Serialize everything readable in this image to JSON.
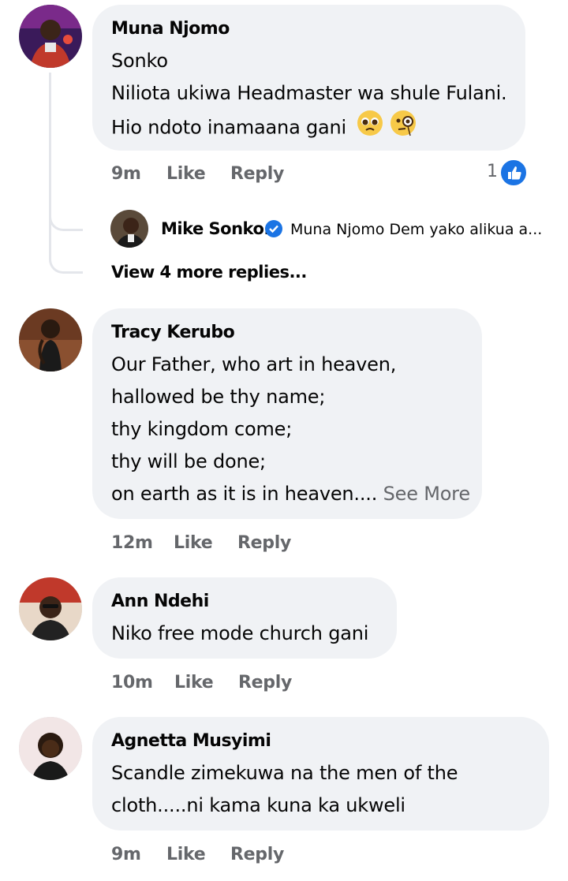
{
  "comments": [
    {
      "author": "Muna Njomo",
      "lines": [
        "Sonko",
        "Niliota ukiwa Headmaster wa shule Fulani.",
        "Hio ndoto inamaana gani"
      ],
      "emojis": [
        "pleading-face-emoji",
        "face-with-monocle-emoji"
      ],
      "time": "9m",
      "like": "Like",
      "reply": "Reply",
      "reaction_count": "1",
      "reply_preview": {
        "author": "Mike Sonko.",
        "text": "Muna Njomo Dem yako alikua a..."
      },
      "view_more": "View 4 more replies..."
    },
    {
      "author": "Tracy Kerubo",
      "lines": [
        "Our Father, who art in heaven,",
        "hallowed be thy name;",
        "thy kingdom come;",
        "thy will be done;",
        "on earth as it is in heaven...."
      ],
      "see_more": "See More",
      "time": "12m",
      "like": "Like",
      "reply": "Reply"
    },
    {
      "author": "Ann Ndehi",
      "lines": [
        "Niko free mode church gani"
      ],
      "time": "10m",
      "like": "Like",
      "reply": "Reply"
    },
    {
      "author": "Agnetta Musyimi",
      "lines": [
        "Scandle zimekuwa na the men of the",
        "cloth.....ni kama kuna ka ukweli"
      ],
      "time": "9m",
      "like": "Like",
      "reply": "Reply"
    }
  ],
  "colors": {
    "bubble": "#f0f2f5",
    "meta": "#65676b",
    "accent": "#1b74e4",
    "thread_line": "#e4e6eb"
  }
}
